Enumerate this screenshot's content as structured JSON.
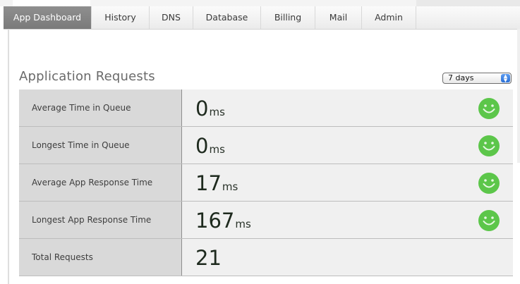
{
  "tabs": [
    {
      "label": "App Dashboard",
      "active": true
    },
    {
      "label": "History",
      "active": false
    },
    {
      "label": "DNS",
      "active": false
    },
    {
      "label": "Database",
      "active": false
    },
    {
      "label": "Billing",
      "active": false
    },
    {
      "label": "Mail",
      "active": false
    },
    {
      "label": "Admin",
      "active": false
    }
  ],
  "section": {
    "title": "Application Requests",
    "range_value": "7 days"
  },
  "metrics": [
    {
      "label": "Average Time in Queue",
      "value": "0",
      "unit": "ms",
      "status_icon": "smiley-face-icon"
    },
    {
      "label": "Longest Time in Queue",
      "value": "0",
      "unit": "ms",
      "status_icon": "smiley-face-icon"
    },
    {
      "label": "Average App Response Time",
      "value": "17",
      "unit": "ms",
      "status_icon": "smiley-face-icon"
    },
    {
      "label": "Longest App Response Time",
      "value": "167",
      "unit": "ms",
      "status_icon": "smiley-face-icon"
    },
    {
      "label": "Total Requests",
      "value": "21",
      "unit": "",
      "status_icon": ""
    }
  ],
  "colors": {
    "active_tab": "#858585",
    "status_good": "#5cc64a",
    "label_cell": "#d9d9d9",
    "value_cell": "#f0f0f0"
  }
}
